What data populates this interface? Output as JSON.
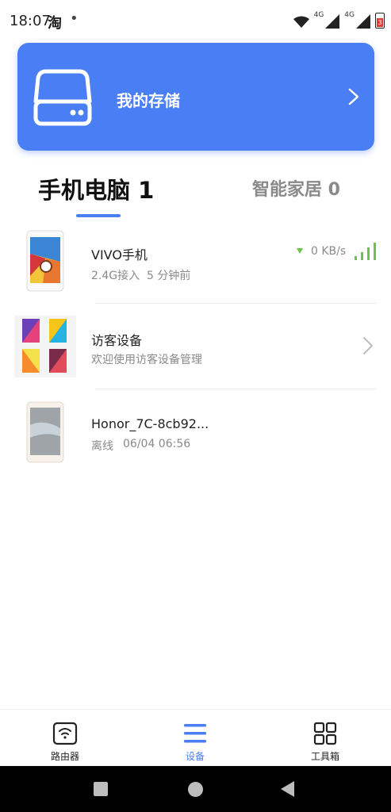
{
  "status_bar": {
    "time": "18:07",
    "app_indicator": "淘",
    "dot": "•",
    "network_labels": [
      "4G",
      "4G"
    ],
    "battery_level": "3",
    "icons": [
      "wifi-icon",
      "cell-signal-icon",
      "cell-signal-icon",
      "battery-icon"
    ]
  },
  "storage_card": {
    "title": "我的存储",
    "icon": "hard-drive-icon",
    "color": "#4a7ef4"
  },
  "tabs": [
    {
      "label": "手机电脑 1",
      "active": true
    },
    {
      "label": "智能家居 0",
      "active": false
    }
  ],
  "devices": [
    {
      "name": "VIVO手机",
      "connection": "2.4G接入",
      "time": "5 分钟前",
      "rate": "0 KB/s",
      "icon": "phone-image"
    },
    {
      "name": "访客设备",
      "subtitle": "欢迎使用访客设备管理",
      "icon": "guest-devices-image"
    },
    {
      "name": "Honor_7C-8cb92...",
      "status": "离线",
      "time": "06/04 06:56",
      "icon": "phone-image"
    }
  ],
  "bottom_nav": [
    {
      "label": "路由器",
      "icon": "router-icon",
      "active": false
    },
    {
      "label": "设备",
      "icon": "list-icon",
      "active": true
    },
    {
      "label": "工具箱",
      "icon": "grid-icon",
      "active": false
    }
  ],
  "colors": {
    "accent": "#4a7ef4",
    "signal_green": "#6cc24a",
    "muted_text": "#8a8a8a"
  }
}
